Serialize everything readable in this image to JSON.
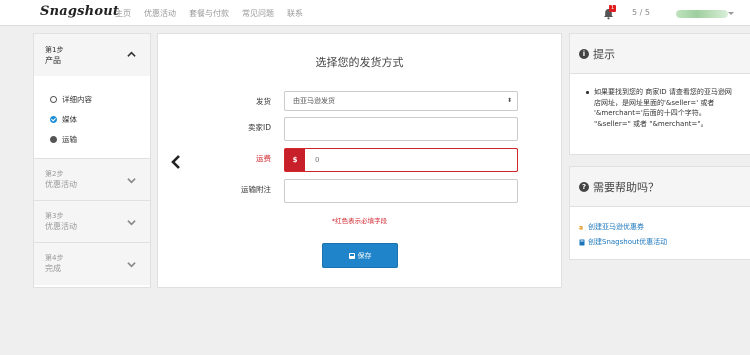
{
  "nav": {
    "logo": "Snagshout",
    "links": [
      "主页",
      "优惠活动",
      "套餐与付款",
      "常见问题",
      "联系"
    ],
    "notification_count": "1",
    "pager": "5 / 5"
  },
  "steps": {
    "step1": {
      "num": "第1步",
      "title": "产品",
      "items": [
        {
          "label": "详细内容",
          "state": "open"
        },
        {
          "label": "媒体",
          "state": "done"
        },
        {
          "label": "运输",
          "state": "current"
        }
      ]
    },
    "step2": {
      "num": "第2步",
      "title": "优惠活动"
    },
    "step3": {
      "num": "第3步",
      "title": "优惠活动"
    },
    "step4": {
      "num": "第4步",
      "title": "完成"
    }
  },
  "form": {
    "title": "选择您的发货方式",
    "shipping_label": "发货",
    "shipping_value": "由亚马逊发货",
    "seller_label": "卖家ID",
    "seller_value": "",
    "fee_label": "运费",
    "fee_currency": "$",
    "fee_value": "0",
    "notes_label": "运输附注",
    "notes_value": "",
    "required_note": "*红色表示必填字段",
    "save_label": "保存"
  },
  "tip": {
    "title": "提示",
    "body": "如果要找到您的 商家ID 请查看您的亚马逊网店网址，是网址里面的'&seller=' 或者 '&merchant='后面的十四个字符。 \"&seller=\" 或者 \"&merchant=\"。"
  },
  "help": {
    "title": "需要帮助吗？",
    "link1": "创建亚马逊优惠券",
    "link2": "创建Snagshout优惠活动"
  },
  "colors": {
    "accent": "#1f84c9",
    "error": "#d0262d",
    "link": "#1a75bb"
  }
}
